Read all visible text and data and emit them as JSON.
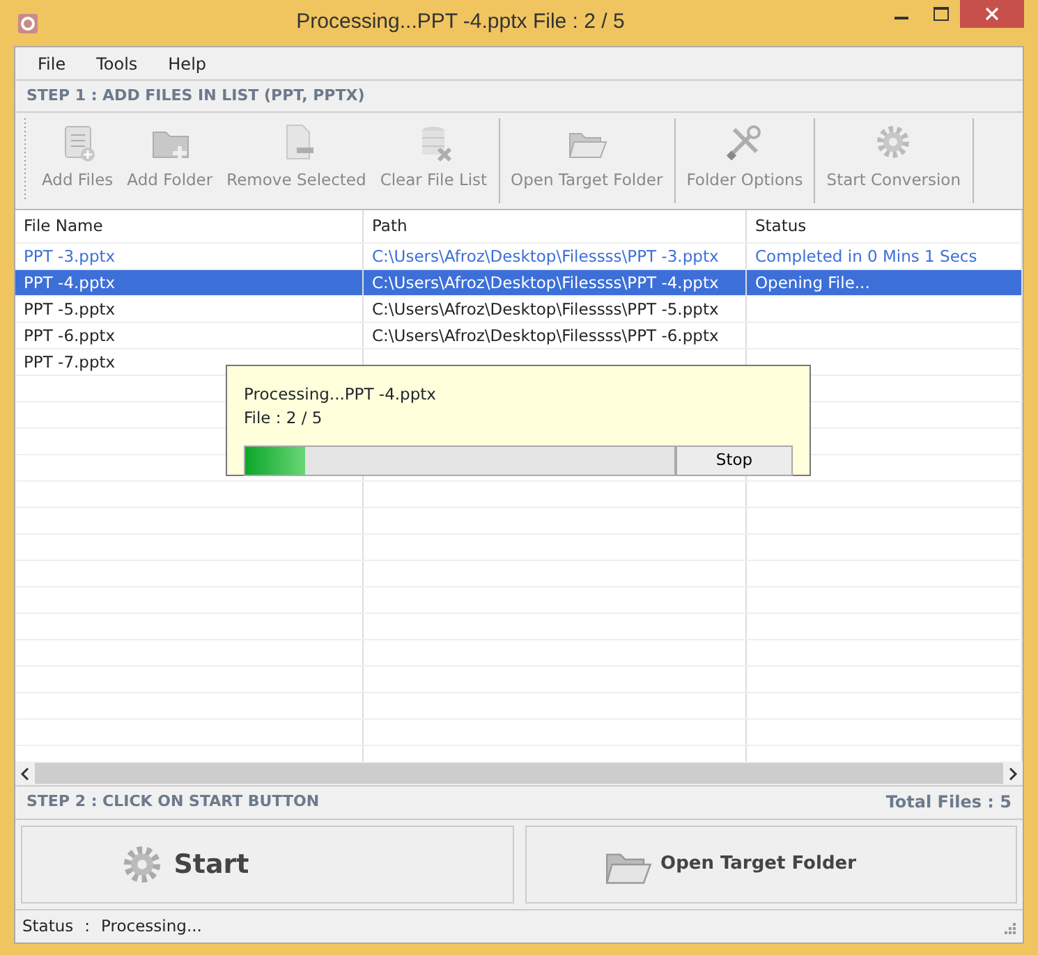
{
  "window": {
    "title": "Processing...PPT -4.pptx File : 2 / 5"
  },
  "menu": [
    "File",
    "Tools",
    "Help"
  ],
  "step1": "STEP 1 : ADD FILES IN LIST (PPT, PPTX)",
  "toolbar": [
    {
      "label": "Add Files",
      "kind": "addfile",
      "disabled": true
    },
    {
      "label": "Add Folder",
      "kind": "addfolder",
      "disabled": true
    },
    {
      "label": "Remove Selected",
      "kind": "remove",
      "disabled": true
    },
    {
      "label": "Clear File List",
      "kind": "clear",
      "disabled": true
    },
    {
      "label": "Open Target Folder",
      "kind": "open",
      "disabled": true
    },
    {
      "label": "Folder Options",
      "kind": "tools",
      "disabled": true
    },
    {
      "label": "Start Conversion",
      "kind": "gear",
      "disabled": true
    }
  ],
  "table": {
    "columns": [
      "File Name",
      "Path",
      "Status"
    ],
    "rows": [
      {
        "name": "PPT -3.pptx",
        "path": "C:\\Users\\Afroz\\Desktop\\Filessss\\PPT -3.pptx",
        "status": "Completed in 0 Mins 1 Secs",
        "done": true,
        "selected": false
      },
      {
        "name": "PPT -4.pptx",
        "path": "C:\\Users\\Afroz\\Desktop\\Filessss\\PPT -4.pptx",
        "status": "Opening File...",
        "done": false,
        "selected": true
      },
      {
        "name": "PPT -5.pptx",
        "path": "C:\\Users\\Afroz\\Desktop\\Filessss\\PPT -5.pptx",
        "done": false,
        "selected": false
      },
      {
        "name": "PPT -6.pptx",
        "path": "C:\\Users\\Afroz\\Desktop\\Filessss\\PPT -6.pptx",
        "done": false,
        "selected": false
      },
      {
        "name": "PPT -7.pptx",
        "done": false,
        "selected": false
      }
    ]
  },
  "dialog": {
    "line1": "Processing...PPT -4.pptx",
    "line2": "File : 2 / 5",
    "progress": {
      "level": 0.14
    },
    "button": "Stop"
  },
  "step2": "STEP 2 : CLICK ON START BUTTON",
  "total": "Total Files : 5",
  "actions": [
    {
      "label": "Start",
      "kind": "gear"
    },
    {
      "label": "Open Target Folder",
      "kind": "open"
    }
  ],
  "status_bar": {
    "label": "Status",
    "separator": ":",
    "value": "Processing..."
  }
}
